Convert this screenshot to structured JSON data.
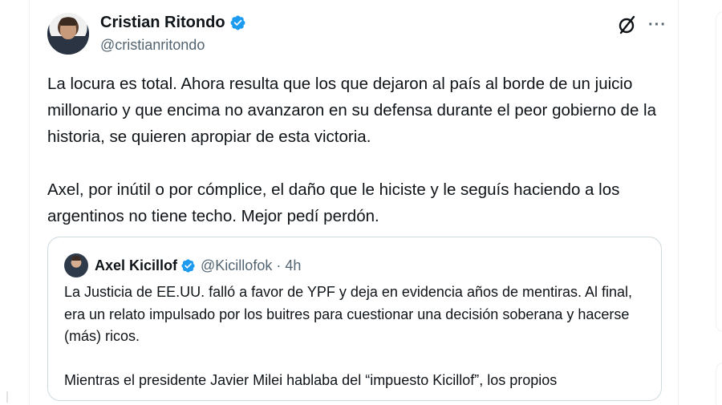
{
  "tweet": {
    "author_name": "Cristian Ritondo",
    "author_handle": "@cristianritondo",
    "verified": true,
    "paragraphs": [
      "La locura es total. Ahora resulta que los que dejaron al país al borde de un juicio millonario y que encima no avanzaron en su defensa durante el peor gobierno de la historia, se quieren apropiar de esta victoria.",
      "Axel, por inútil o por cómplice, el daño que le hiciste y le seguís haciendo a los argentinos no tiene techo. Mejor pedí perdón."
    ],
    "icons": [
      "grok-icon",
      "more-icon"
    ],
    "more_label": "···"
  },
  "quoted": {
    "author_name": "Axel Kicillof",
    "author_handle": "@Kicillofok",
    "separator": "·",
    "time": "4h",
    "verified": true,
    "paragraphs": [
      "La Justicia de EE.UU. falló a favor de YPF y deja en evidencia años de mentiras. Al final, era un relato impulsado por los buitres para cuestionar una decisión soberana y hacerse (más) ricos.",
      "Mientras el presidente Javier Milei hablaba del “impuesto Kicillof”, los propios"
    ]
  },
  "colors": {
    "verified_blue": "#1d9bf0",
    "text_primary": "#0f1419",
    "text_secondary": "#536471",
    "border": "#cfd9de"
  }
}
